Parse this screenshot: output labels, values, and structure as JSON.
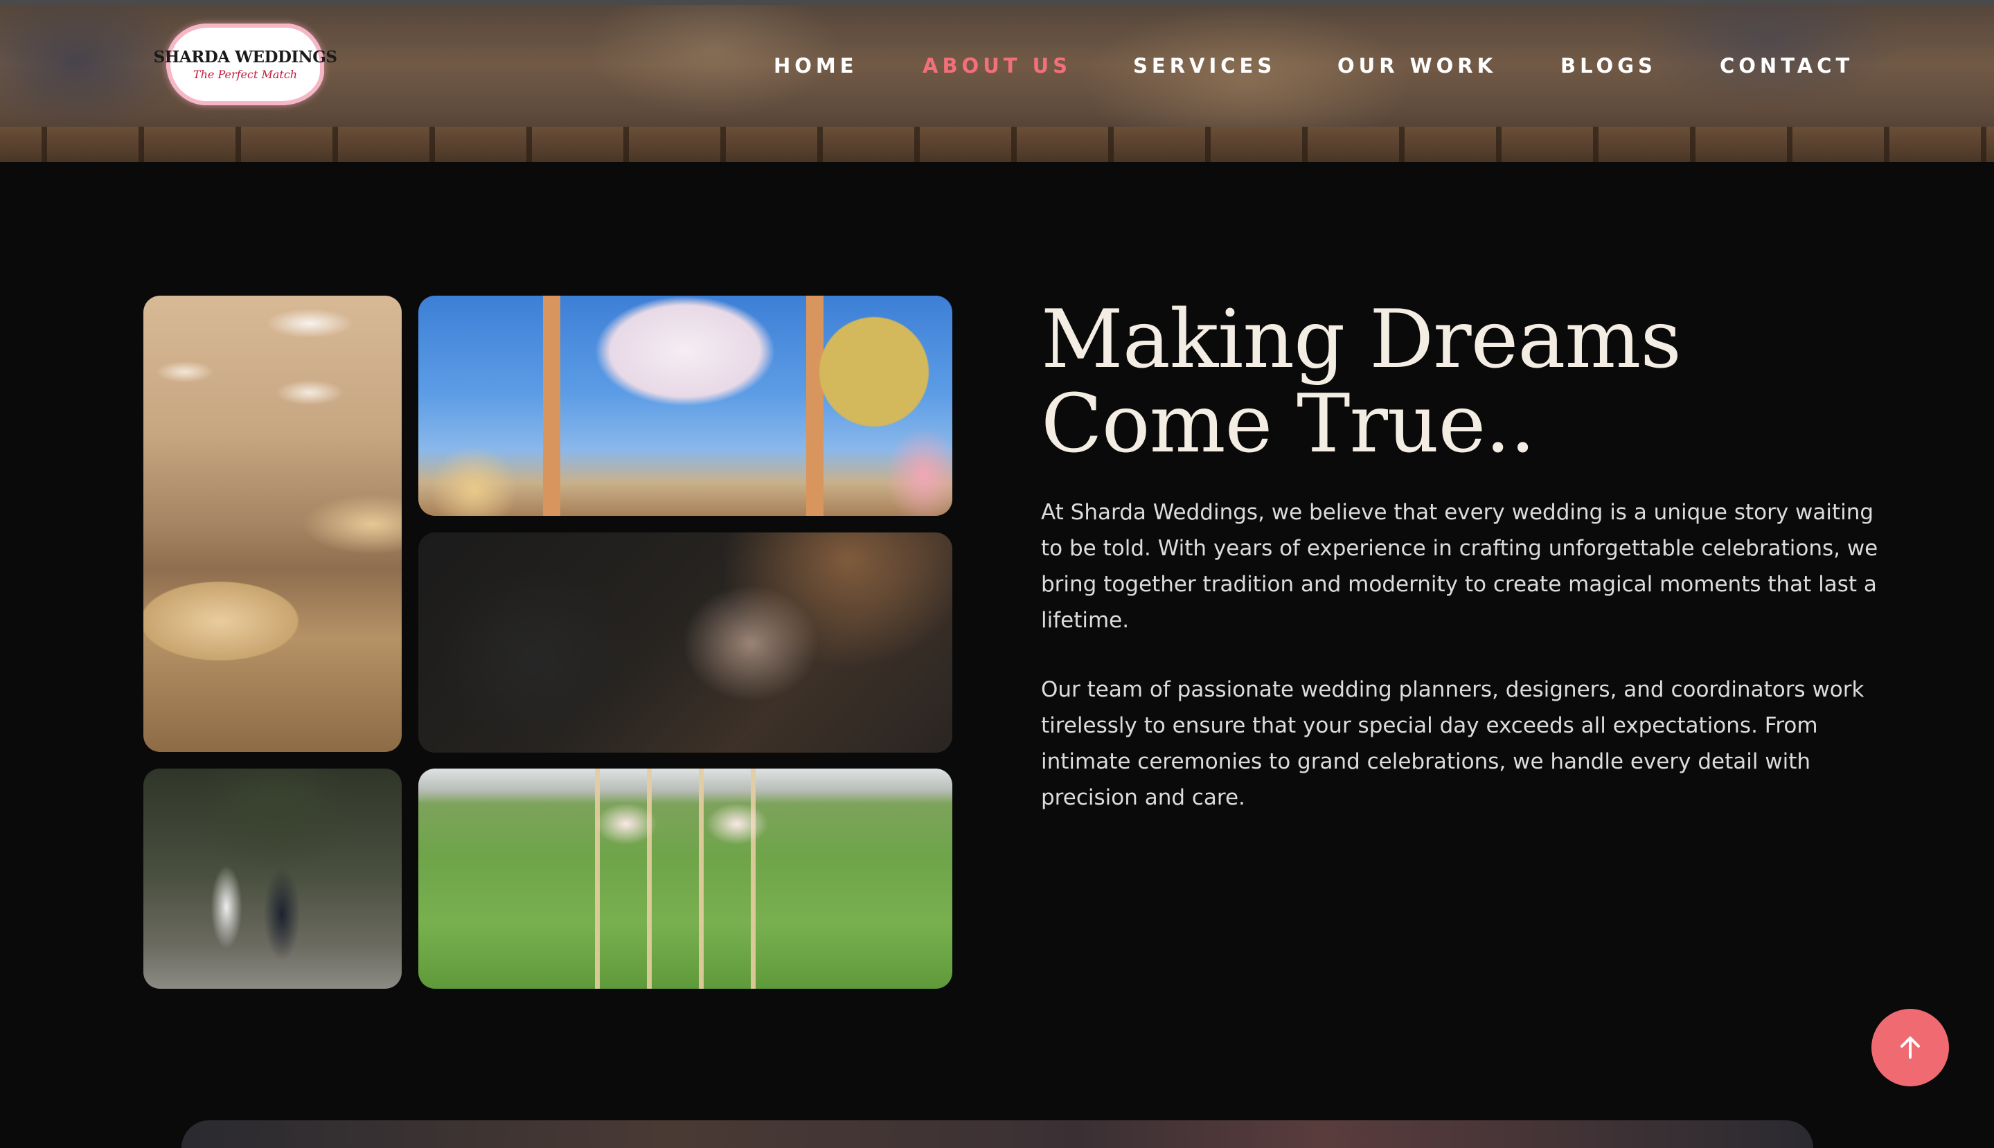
{
  "brand": {
    "name": "SHARDA WEDDINGS",
    "tagline": "The Perfect Match"
  },
  "nav": {
    "items": [
      {
        "label": "HOME",
        "active": false
      },
      {
        "label": "ABOUT US",
        "active": true
      },
      {
        "label": "SERVICES",
        "active": false
      },
      {
        "label": "OUR WORK",
        "active": false
      },
      {
        "label": "BLOGS",
        "active": false
      },
      {
        "label": "CONTACT",
        "active": false
      }
    ]
  },
  "about": {
    "title_line1": "Making Dreams",
    "title_line2": "Come True..",
    "paragraph1": "At Sharda Weddings, we believe that every wedding is a unique story waiting to be told. With years of experience in crafting unforgettable celebrations, we bring together tradition and modernity to create magical moments that last a lifetime.",
    "paragraph2": "Our team of passionate wedding planners, designers, and coordinators work tirelessly to ensure that your special day exceeds all expectations. From intimate ceremonies to grand celebrations, we handle every detail with precision and care."
  },
  "gallery": {
    "photos": [
      "ballroom-photo",
      "mandap-ceremony-photo",
      "bouquet-photo",
      "couple-photo",
      "garden-chairs-photo"
    ]
  },
  "colors": {
    "background": "#0a0a0a",
    "accent": "#f06a72",
    "active_nav": "#f2707a",
    "title_text": "#f3ede3"
  },
  "icons": {
    "scroll_top": "arrow-up-icon"
  }
}
